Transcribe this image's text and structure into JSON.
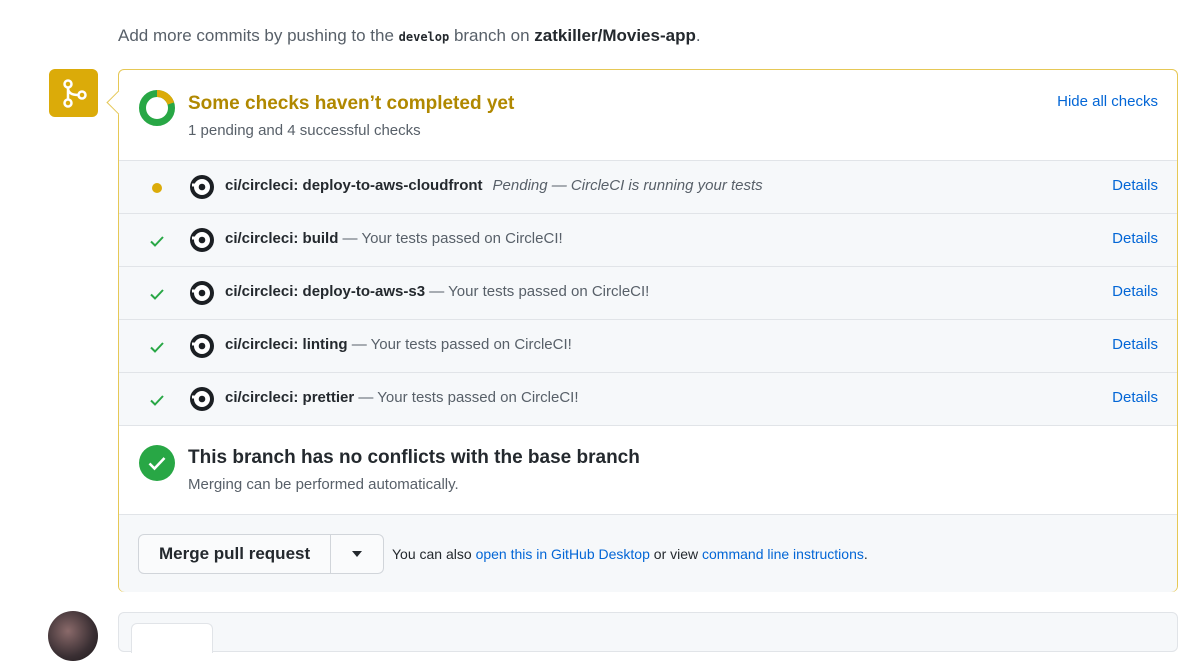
{
  "hint": {
    "prefix": "Add more commits by pushing to the ",
    "branch": "develop",
    "middle": " branch on ",
    "repo": "zatkiller/Movies-app",
    "suffix": "."
  },
  "checks": {
    "title": "Some checks haven’t completed yet",
    "summary": "1 pending and 4 successful checks",
    "hide_label": "Hide all checks",
    "items": [
      {
        "status": "pending",
        "name": "ci/circleci: deploy-to-aws-cloudfront",
        "description": "Pending — CircleCI is running your tests",
        "details": "Details"
      },
      {
        "status": "success",
        "name": "ci/circleci: build",
        "description": " — Your tests passed on CircleCI!",
        "details": "Details"
      },
      {
        "status": "success",
        "name": "ci/circleci: deploy-to-aws-s3",
        "description": " — Your tests passed on CircleCI!",
        "details": "Details"
      },
      {
        "status": "success",
        "name": "ci/circleci: linting",
        "description": " — Your tests passed on CircleCI!",
        "details": "Details"
      },
      {
        "status": "success",
        "name": "ci/circleci: prettier",
        "description": " — Your tests passed on CircleCI!",
        "details": "Details"
      }
    ]
  },
  "conflicts": {
    "title": "This branch has no conflicts with the base branch",
    "subtitle": "Merging can be performed automatically."
  },
  "merge": {
    "button_label": "Merge pull request",
    "note_prefix": "You can also ",
    "desktop_link": "open this in GitHub Desktop",
    "note_middle": " or view ",
    "cli_link": "command line instructions",
    "note_suffix": "."
  },
  "colors": {
    "pending": "#dbab09",
    "success": "#28a745",
    "link": "#0366d6",
    "warning_text": "#b08800"
  },
  "icons": {
    "merge_badge": "git-merge-icon",
    "pending_status": "pending-dot-icon",
    "success_status": "check-icon",
    "ci_logo": "circleci-logo-icon",
    "conflict_status": "check-circle-icon",
    "dropdown": "triangle-down-icon"
  }
}
